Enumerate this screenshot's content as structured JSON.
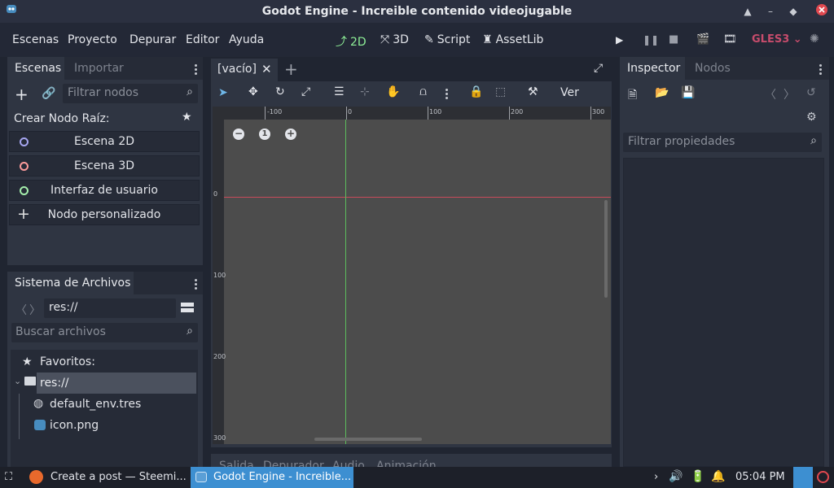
{
  "window": {
    "title": "Godot Engine - Increible contenido videojugable"
  },
  "menubar": {
    "menus": [
      "Escenas",
      "Proyecto",
      "Depurar",
      "Editor",
      "Ayuda"
    ],
    "workspaces": [
      "2D",
      "3D",
      "Script",
      "AssetLib"
    ],
    "renderer": "GLES3"
  },
  "scene_dock": {
    "tabs": [
      "Escenas",
      "Importar"
    ],
    "filter_placeholder": "Filtrar nodos",
    "create_root_label": "Crear Nodo Raíz:",
    "root_options": [
      {
        "label": "Escena 2D",
        "color": "#a6a6f0"
      },
      {
        "label": "Escena 3D",
        "color": "#fc9b9b"
      },
      {
        "label": "Interfaz de usuario",
        "color": "#a5efac"
      },
      {
        "label": "Nodo personalizado",
        "color": "#e0e0e0"
      }
    ]
  },
  "filesystem_dock": {
    "title": "Sistema de Archivos",
    "path": "res://",
    "search_placeholder": "Buscar archivos",
    "favorites_label": "Favoritos:",
    "root_folder": "res://",
    "files": [
      "default_env.tres",
      "icon.png"
    ]
  },
  "editor": {
    "scene_tab": "[vacío]",
    "view_menu": "Ver",
    "zoom_reset": "1",
    "ruler_h_labels": [
      "-100",
      "0",
      "100",
      "200",
      "300"
    ],
    "ruler_v_labels": [
      "0",
      "100",
      "200",
      "300"
    ],
    "bottom_tabs": [
      "Salida",
      "Depurador",
      "Audio",
      "Animación"
    ]
  },
  "inspector_dock": {
    "tabs": [
      "Inspector",
      "Nodos"
    ],
    "filter_placeholder": "Filtrar propiedades"
  },
  "taskbar": {
    "apps": [
      {
        "label": "Create a post — Steemi...",
        "active": false
      },
      {
        "label": "Godot Engine - Increible...",
        "active": true
      }
    ],
    "time": "05:04 PM"
  },
  "colors": {
    "accent": "#6fb7e8",
    "workspace_active": "#8eef97",
    "renderer": "#c74c6c",
    "axis_x": "#c84a5b",
    "axis_y": "#5dbd5d"
  }
}
